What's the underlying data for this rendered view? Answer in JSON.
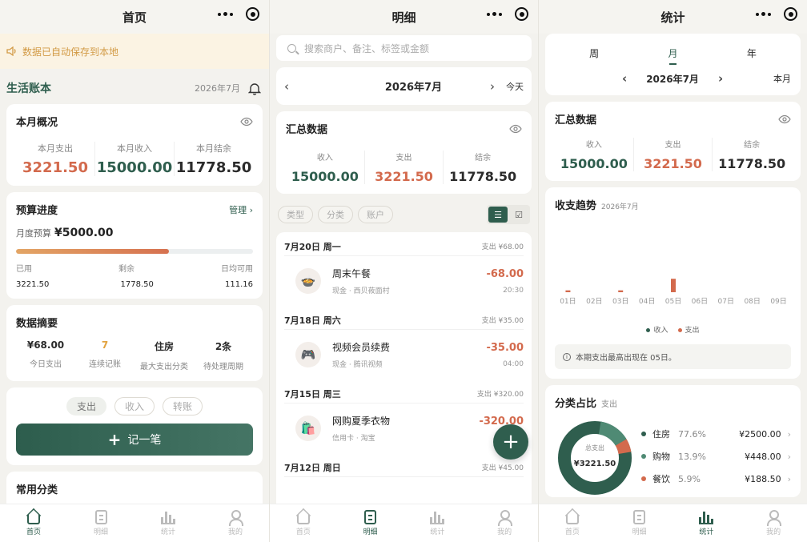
{
  "screen_home": {
    "title": "首页",
    "banner": "数据已自动保存到本地",
    "book_title": "生活账本",
    "book_month": "2026年7月",
    "overview": {
      "title": "本月概况",
      "items": [
        {
          "label": "本月支出",
          "value": "3221.50"
        },
        {
          "label": "本月收入",
          "value": "15000.00"
        },
        {
          "label": "本月结余",
          "value": "11778.50"
        }
      ]
    },
    "budget": {
      "title": "预算进度",
      "manage": "管理",
      "monthly_label": "月度预算",
      "monthly_value": "¥5000.00",
      "progress_fraction": 0.644,
      "labels": [
        "已用",
        "剩余",
        "日均可用"
      ],
      "values": [
        "3221.50",
        "1778.50",
        "111.16"
      ]
    },
    "summary": {
      "title": "数据摘要",
      "items": [
        {
          "value": "¥68.00",
          "label": "今日支出"
        },
        {
          "value": "7",
          "label": "连续记账"
        },
        {
          "value": "住房",
          "label": "最大支出分类"
        },
        {
          "value": "2条",
          "label": "待处理周期"
        }
      ]
    },
    "record": {
      "tabs": [
        "支出",
        "收入",
        "转账"
      ],
      "button": "记一笔"
    },
    "common_title": "常用分类"
  },
  "screen_detail": {
    "title": "明细",
    "search_placeholder": "搜索商户、备注、标签或金额",
    "month": "2026年7月",
    "today": "今天",
    "summary": {
      "title": "汇总数据",
      "items": [
        {
          "label": "收入",
          "value": "15000.00"
        },
        {
          "label": "支出",
          "value": "3221.50"
        },
        {
          "label": "结余",
          "value": "11778.50"
        }
      ]
    },
    "filters": [
      "类型",
      "分类",
      "账户"
    ],
    "days": [
      {
        "date": "7月20日 周一",
        "total": "支出 ¥68.00",
        "tx": {
          "icon": "🍲",
          "name": "周末午餐",
          "sub": "现金 · 西贝莜面村",
          "amount": "-68.00",
          "time": "20:30"
        }
      },
      {
        "date": "7月18日 周六",
        "total": "支出 ¥35.00",
        "tx": {
          "icon": "🎮",
          "name": "视频会员续费",
          "sub": "现金 · 腾讯视频",
          "amount": "-35.00",
          "time": "04:00"
        }
      },
      {
        "date": "7月15日 周三",
        "total": "支出 ¥320.00",
        "tx": {
          "icon": "🛍️",
          "name": "网购夏季衣物",
          "sub": "信用卡 · 淘宝",
          "amount": "-320.00",
          "time": "23:20"
        }
      },
      {
        "date": "7月12日 周日",
        "total": "支出 ¥45.00"
      }
    ],
    "fab": "+"
  },
  "screen_stats": {
    "title": "统计",
    "period_tabs": [
      "周",
      "月",
      "年"
    ],
    "month": "2026年7月",
    "this_month": "本月",
    "summary": {
      "title": "汇总数据",
      "items": [
        {
          "label": "收入",
          "value": "15000.00"
        },
        {
          "label": "支出",
          "value": "3221.50"
        },
        {
          "label": "结余",
          "value": "11778.50"
        }
      ]
    },
    "trend": {
      "title": "收支趋势",
      "subtitle": "2026年7月",
      "note": "本期支出最高出现在 05日。",
      "legend": [
        "收入",
        "支出"
      ]
    },
    "category": {
      "title": "分类占比",
      "subtitle": "支出",
      "center_label": "总支出",
      "center_value": "¥3221.50",
      "rows": [
        {
          "name": "住房",
          "pct": "77.6%",
          "amount": "¥2500.00",
          "color": "#2f5e4e"
        },
        {
          "name": "购物",
          "pct": "13.9%",
          "amount": "¥448.00",
          "color": "#4f8a74"
        },
        {
          "name": "餐饮",
          "pct": "5.9%",
          "amount": "¥188.50",
          "color": "#d36a4d"
        }
      ]
    }
  },
  "chart_data": {
    "type": "bar",
    "categories": [
      "01日",
      "02日",
      "03日",
      "04日",
      "05日",
      "06日",
      "07日",
      "08日",
      "09日"
    ],
    "series": [
      {
        "name": "收入",
        "values": [
          0,
          0,
          0,
          0,
          0,
          0,
          0,
          0,
          0
        ]
      },
      {
        "name": "支出",
        "values": [
          8,
          0,
          8,
          0,
          58,
          0,
          0,
          0,
          0
        ]
      }
    ],
    "title": "收支趋势",
    "subtitle": "2026年7月",
    "grid": false,
    "legend": "bottom"
  },
  "tabbar": [
    "首页",
    "明细",
    "统计",
    "我的"
  ],
  "colors": {
    "primary": "#2f5e4e",
    "expense": "#d36a4d",
    "banner": "#d29a45"
  }
}
